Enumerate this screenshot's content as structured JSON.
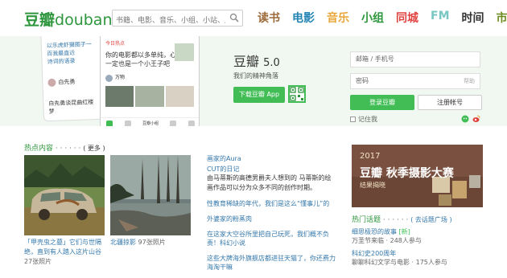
{
  "header": {
    "logo_cn": "豆瓣",
    "logo_en": "douban",
    "search_placeholder": "书籍、电影、音乐、小组、小站、成员",
    "nav": [
      {
        "label": "读书",
        "color": "#9b6a39"
      },
      {
        "label": "电影",
        "color": "#2385b3"
      },
      {
        "label": "音乐",
        "color": "#e8a63b"
      },
      {
        "label": "小组",
        "color": "#2e963d"
      },
      {
        "label": "同城",
        "color": "#e0423f"
      },
      {
        "label": "FM",
        "color": "#79c6c2"
      },
      {
        "label": "时间",
        "color": "#333333"
      },
      {
        "label": "市集",
        "color": "#6b8b1e"
      }
    ]
  },
  "banner": {
    "phone1_lines": [
      "以乐虎虾摄图子一百我最直近",
      "诗词的语录"
    ],
    "phone2_lines": [
      "你的电影都以多单纯，心里",
      "一定也是一个小王子吧"
    ],
    "phone2_tag": "今日热点",
    "phone1_caption": "白先勇谈昆曲红楼梦",
    "phone1_user": "白先勇",
    "phone2_user": "万物",
    "phone2_bottom": "豆瓣小组",
    "app_name": "豆瓣",
    "app_version": "5.0",
    "slogan": "我们的精神角落",
    "download_label": "下载豆瓣 App"
  },
  "login": {
    "account_placeholder": "邮箱 / 手机号",
    "password_placeholder": "密码",
    "help": "帮助",
    "login_label": "登录豆瓣",
    "register_label": "注册帐号",
    "remember_label": "记住我"
  },
  "hot": {
    "title": "热点内容",
    "dots": "· · · · · ·",
    "more": "( 更多 )",
    "photos": [
      {
        "caption": "「甲壳虫之墓」它们与世隔绝，直到有人踏入这片山谷",
        "count": "27张照片"
      },
      {
        "caption": "北疆掠影",
        "count": "97张照片"
      }
    ],
    "articles": [
      {
        "title": "画家的Aura",
        "desc": ""
      },
      {
        "title": "CUT的日记",
        "desc": "由马蒂斯的高德男爵夫人想到的 马蒂斯的绘画作品可以分为众多不同的创作时期。"
      },
      {
        "title": "性教育稀缺的年代，我们是这么“懂事儿”的",
        "desc": ""
      },
      {
        "title": "外婆家的粉蒸肉",
        "desc": ""
      },
      {
        "title": "在这家大空谷所里把自己玩死，我们概不负责！科幻小说",
        "desc": ""
      },
      {
        "title": "这些大牌海外旗舰店都进驻天猫了，你还费力海淘干嘛",
        "desc": ""
      }
    ]
  },
  "ad": {
    "year": "2017",
    "title": "豆瓣 秋季摄影大赛",
    "subtitle": "结果揭晓"
  },
  "topics": {
    "title": "热门话题",
    "dots": "· · · · · ·",
    "go": "( 去话题广场 )",
    "items": [
      {
        "title": "细思极恐的故事",
        "badge": "新",
        "meta": "万圣节来临 · 248人参与"
      },
      {
        "title": "科幻史200周年",
        "badge": "",
        "meta": "聊聊科幻文学与电影 · 175人参与"
      }
    ]
  }
}
